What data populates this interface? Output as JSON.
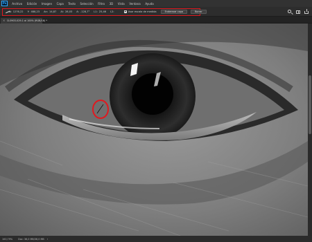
{
  "app": {
    "logo": "Ps"
  },
  "menu": [
    "Archivo",
    "Edición",
    "Imagen",
    "Capa",
    "Texto",
    "Selección",
    "Filtro",
    "3D",
    "Vista",
    "Ventana",
    "Ayuda"
  ],
  "options": {
    "x_label": "X:",
    "x_value": "1276,22",
    "y_label": "Y:",
    "y_value": "488,23",
    "an_label": "An:",
    "an_value": "14,87",
    "al_label": "Al:",
    "al_value": "28,03",
    "angle_label": "A:",
    "angle_value": "-128,7°",
    "l1_label": "L1:",
    "l1_value": "25,46",
    "l2_label": "L2:",
    "use_scale_label": "Usar escala de medida",
    "straighten_label": "Enderezar capa",
    "clear_label": "Borrar"
  },
  "tab": {
    "close": "×",
    "title": "D-0903-029-1 al 100% (RGB/16) *"
  },
  "status": {
    "zoom": "100,79%",
    "doc": "Doc: 36,0 MB/36,0 MB",
    "arrow": "›"
  },
  "colors": {
    "highlight": "#e0191f",
    "accent": "#31a8ff"
  },
  "icons": [
    "ruler-tool-icon",
    "search-icon",
    "workspace-icon",
    "share-icon",
    "close-icon"
  ]
}
